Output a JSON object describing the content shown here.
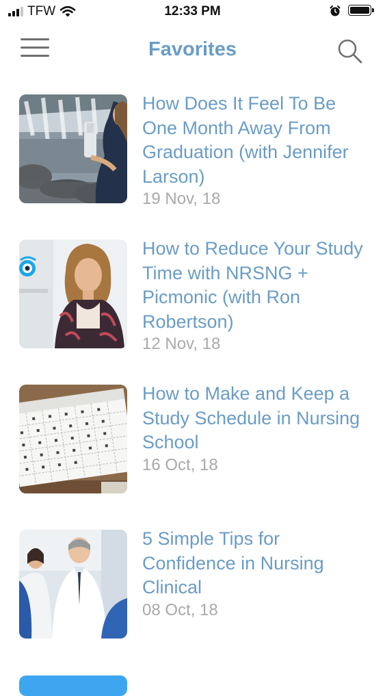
{
  "status_bar": {
    "carrier": "TFW",
    "time": "12:33 PM",
    "icons": [
      "signal-icon",
      "wifi-icon",
      "alarm-icon",
      "battery-icon"
    ]
  },
  "nav": {
    "title": "Favorites",
    "left_icon": "hamburger-menu-icon",
    "right_icon": "search-icon"
  },
  "favorites": [
    {
      "title": "How Does It Feel To Be One Month Away From Graduation (with Jennifer Larson)",
      "date": "19 Nov, 18",
      "thumbnail": "waterfall-graduate-photo"
    },
    {
      "title": "How to Reduce Your Study Time with NRSNG + Picmonic (with Ron Robertson)",
      "date": "12 Nov, 18",
      "thumbnail": "student-laptop-photo"
    },
    {
      "title": "How to Make and Keep a Study Schedule in Nursing School",
      "date": "16 Oct, 18",
      "thumbnail": "calendar-photo"
    },
    {
      "title": "5 Simple Tips for Confidence in Nursing Clinical",
      "date": "08 Oct, 18",
      "thumbnail": "doctors-photo"
    }
  ],
  "colors": {
    "accent": "#6a9cc6",
    "date_text": "#a9a9a9",
    "button": "#3ea6f0"
  }
}
